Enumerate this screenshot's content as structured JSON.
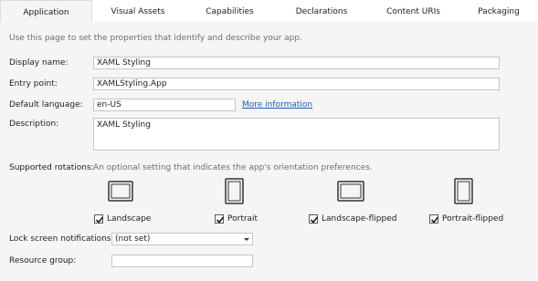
{
  "tabs": [
    {
      "label": "Application",
      "active": true
    },
    {
      "label": "Visual Assets",
      "active": false
    },
    {
      "label": "Capabilities",
      "active": false
    },
    {
      "label": "Declarations",
      "active": false
    },
    {
      "label": "Content URIs",
      "active": false
    },
    {
      "label": "Packaging",
      "active": false
    }
  ],
  "intro": "Use this page to set the properties that identify and describe your app.",
  "fields": {
    "display_name": {
      "label": "Display name:",
      "value": "XAML Styling"
    },
    "entry_point": {
      "label": "Entry point:",
      "value": "XAMLStyling.App"
    },
    "default_language": {
      "label": "Default language:",
      "value": "en-US",
      "link": "More information"
    },
    "description": {
      "label": "Description:",
      "value": "XAML Styling"
    }
  },
  "rotations": {
    "label": "Supported rotations:",
    "hint": "An optional setting that indicates the app's orientation preferences.",
    "items": [
      {
        "label": "Landscape",
        "checked": true,
        "icon": "landscape-tablet-icon"
      },
      {
        "label": "Portrait",
        "checked": true,
        "icon": "portrait-tablet-icon"
      },
      {
        "label": "Landscape-flipped",
        "checked": true,
        "icon": "landscape-flipped-tablet-icon"
      },
      {
        "label": "Portrait-flipped",
        "checked": true,
        "icon": "portrait-flipped-tablet-icon"
      }
    ]
  },
  "lock_screen": {
    "label": "Lock screen notifications:",
    "value": "(not set)"
  },
  "resource_group": {
    "label": "Resource group:",
    "value": ""
  },
  "colors": {
    "link": "#1a5fb4",
    "panel": "#f5f5f5"
  }
}
